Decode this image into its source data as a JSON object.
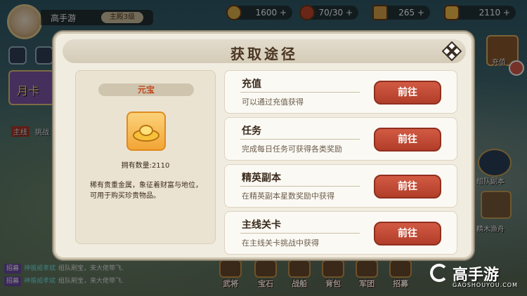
{
  "player": {
    "name": "高手游",
    "rank": "主殿3级"
  },
  "resources": [
    {
      "value": "1600",
      "icon": "coin-icon"
    },
    {
      "value": "70/30",
      "icon": "meat-icon"
    },
    {
      "value": "265",
      "icon": "ticket-icon"
    },
    {
      "value": "2110",
      "icon": "ingot-icon"
    }
  ],
  "resource_plus": "+",
  "side_labels": {
    "recharge": "充值",
    "team_dungeon": "组队副本",
    "elite_fishing": "精木渔舟",
    "monthly_card": "月卡",
    "main_line": "主线",
    "challenge": "挑战"
  },
  "chat": [
    {
      "tag": "招募",
      "name": "神循威孝斌",
      "text": "组队刷宝，来大佬带飞."
    },
    {
      "tag": "招募",
      "name": "神循威孝斌",
      "text": "组队刷宝，来大佬带飞."
    }
  ],
  "nav": [
    {
      "label": "武将",
      "icon": "general-icon"
    },
    {
      "label": "宝石",
      "icon": "gem-icon"
    },
    {
      "label": "战船",
      "icon": "warship-icon"
    },
    {
      "label": "背包",
      "icon": "bag-icon"
    },
    {
      "label": "军团",
      "icon": "legion-icon"
    },
    {
      "label": "招募",
      "icon": "recruit-icon"
    }
  ],
  "modal": {
    "title": "获取途径",
    "item": {
      "name": "元宝",
      "owned": "拥有数量:2110",
      "description": "稀有贵重金属，象征着财富与地位，可用于购买珍贵物品。"
    },
    "sources": [
      {
        "title": "充值",
        "desc": "可以通过充值获得",
        "button": "前往"
      },
      {
        "title": "任务",
        "desc": "完成每日任务可获得各类奖励",
        "button": "前往"
      },
      {
        "title": "精英副本",
        "desc": "在精英副本星数奖励中获得",
        "button": "前往"
      },
      {
        "title": "主线关卡",
        "desc": "在主线关卡挑战中获得",
        "button": "前往"
      }
    ]
  },
  "watermark": {
    "text": "高手游",
    "url": "GAOSHOUYOU.COM"
  },
  "colors": {
    "accent_red": "#b13e2a",
    "item_name": "#c0481e",
    "panel_bg": "#f1ece0"
  }
}
